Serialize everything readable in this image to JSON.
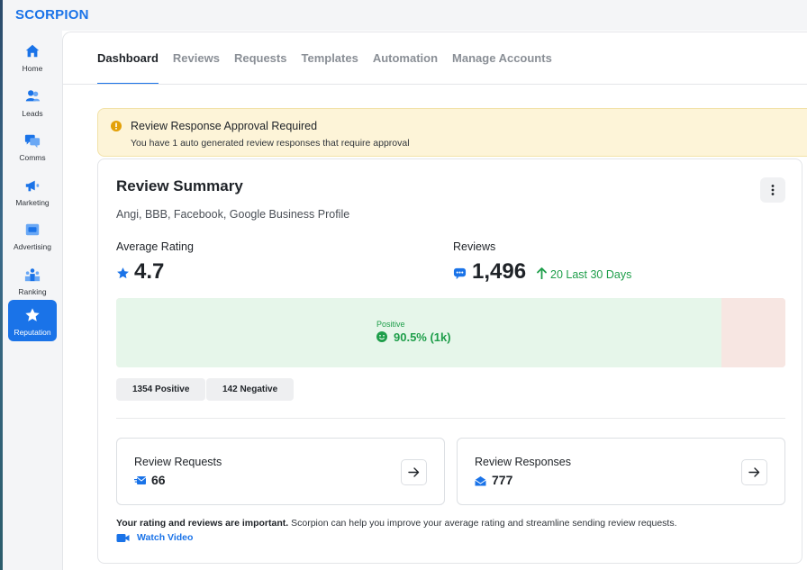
{
  "app": {
    "logo": "SCORPION"
  },
  "sidebar": {
    "items": [
      {
        "label": "Home",
        "icon": "home-icon"
      },
      {
        "label": "Leads",
        "icon": "leads-icon"
      },
      {
        "label": "Comms",
        "icon": "comms-icon"
      },
      {
        "label": "Marketing",
        "icon": "megaphone-icon"
      },
      {
        "label": "Advertising",
        "icon": "ad-icon"
      },
      {
        "label": "Ranking",
        "icon": "ranking-icon"
      },
      {
        "label": "Reputation",
        "icon": "star-icon",
        "active": true
      }
    ]
  },
  "tabs": [
    "Dashboard",
    "Reviews",
    "Requests",
    "Templates",
    "Automation",
    "Manage Accounts"
  ],
  "alert": {
    "title": "Review Response Approval Required",
    "text": "You have 1 auto generated review responses that require approval"
  },
  "summary": {
    "title": "Review Summary",
    "sources": "Angi, BBB, Facebook, Google Business Profile",
    "average_rating_label": "Average Rating",
    "average_rating": "4.7",
    "reviews_label": "Reviews",
    "reviews_total": "1,496",
    "reviews_trend": "20 Last 30 Days",
    "sentiment": {
      "positive_label": "Positive",
      "positive_value": "90.5% (1k)",
      "positive_fraction": 0.905
    },
    "chips": {
      "positive": "1354 Positive",
      "negative": "142 Negative"
    },
    "review_requests": {
      "label": "Review Requests",
      "value": "66"
    },
    "review_responses": {
      "label": "Review Responses",
      "value": "777"
    },
    "footer": {
      "bold": "Your rating and reviews are important.",
      "text": " Scorpion can help you improve your average rating and streamline sending review requests.",
      "video_link": "Watch Video"
    }
  },
  "colors": {
    "brand": "#1a73e8",
    "positive": "#1e9e4a",
    "positive_bg": "#e6f6ea",
    "negative_bg": "#f7e6e2",
    "alert_bg": "#fdf4d8",
    "warning": "#e3a008"
  }
}
